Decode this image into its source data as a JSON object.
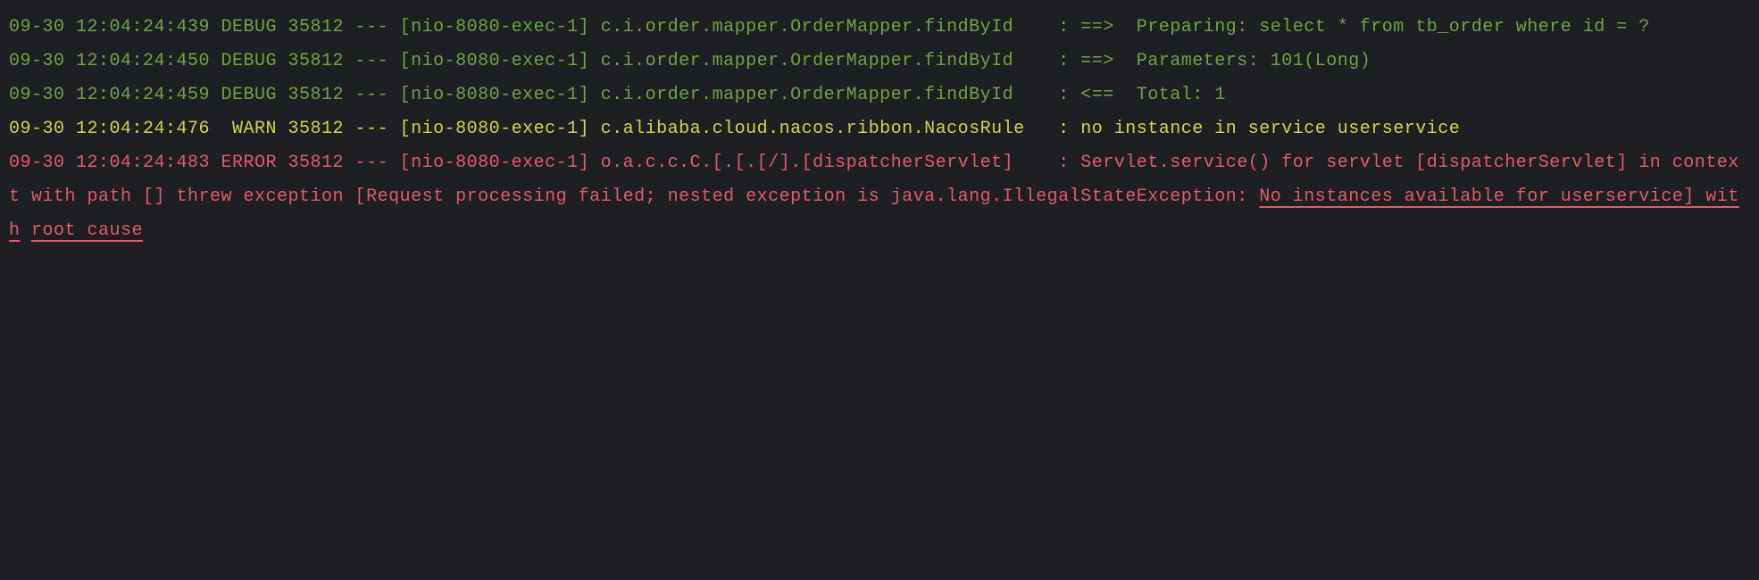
{
  "log_entries": [
    {
      "level": "DEBUG",
      "timestamp": "09-30 12:04:24:439",
      "pid": "35812",
      "sep": "---",
      "thread": "[nio-8080-exec-1]",
      "logger": "c.i.order.mapper.OrderMapper.findById",
      "colon": ":",
      "message": "==>  Preparing: select * from tb_order where id = ?"
    },
    {
      "level": "DEBUG",
      "timestamp": "09-30 12:04:24:450",
      "pid": "35812",
      "sep": "---",
      "thread": "[nio-8080-exec-1]",
      "logger": "c.i.order.mapper.OrderMapper.findById",
      "colon": ":",
      "message": "==>  Parameters: 101(Long)"
    },
    {
      "level": "DEBUG",
      "timestamp": "09-30 12:04:24:459",
      "pid": "35812",
      "sep": "---",
      "thread": "[nio-8080-exec-1]",
      "logger": "c.i.order.mapper.OrderMapper.findById",
      "colon": ":",
      "message": "<==  Total: 1"
    },
    {
      "level": "WARN",
      "timestamp": "09-30 12:04:24:476",
      "pid": "35812",
      "sep": "---",
      "thread": "[nio-8080-exec-1]",
      "logger": "c.alibaba.cloud.nacos.ribbon.NacosRule",
      "colon": ":",
      "message": "no instance in service userservice"
    },
    {
      "level": "ERROR",
      "timestamp": "09-30 12:04:24:483",
      "pid": "35812",
      "sep": "---",
      "thread": "[nio-8080-exec-1]",
      "logger": "o.a.c.c.C.[.[.[/].[dispatcherServlet]",
      "colon": ":",
      "message_parts": [
        {
          "text": "Servlet.service() for servlet [dispatcherServlet] in context with path [] threw exception [Request processing failed; nested exception is java.lang.IllegalStateException: ",
          "underline": false
        },
        {
          "text": "No instances available for userservice] with",
          "underline": true
        },
        {
          "text": " ",
          "underline": false
        },
        {
          "text": "root cause",
          "underline": true
        }
      ]
    }
  ],
  "colors": {
    "DEBUG": "#6fa345",
    "WARN": "#d6d24a",
    "ERROR": "#e05c65",
    "bg": "#1e1f22"
  },
  "level_field_width": 5,
  "logger_field_width": 40
}
